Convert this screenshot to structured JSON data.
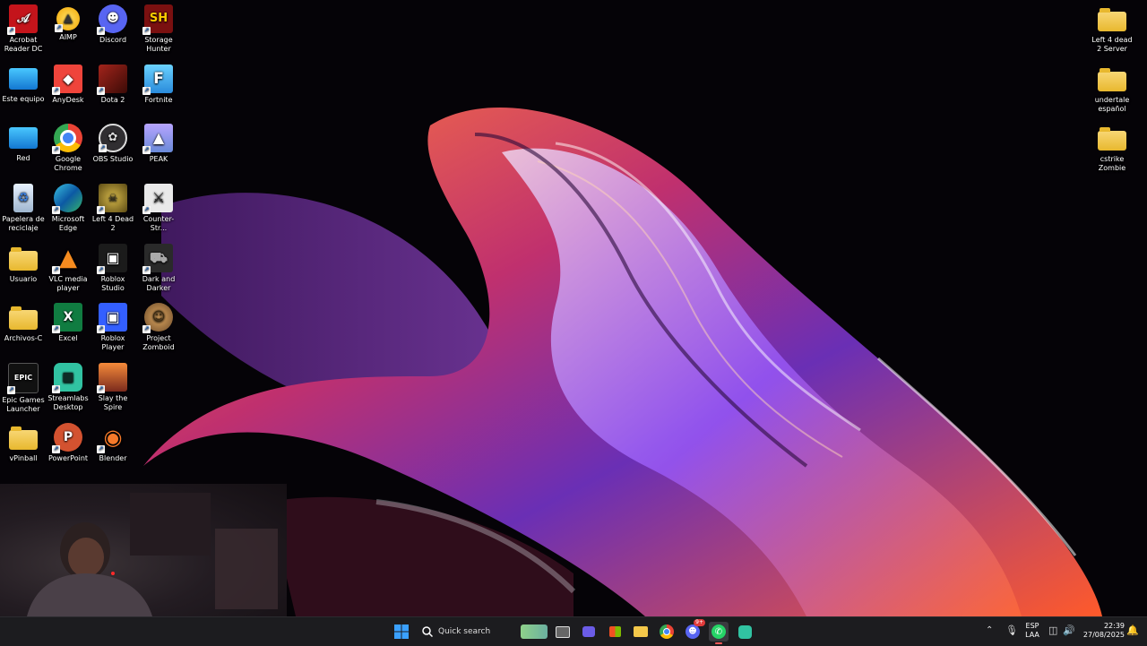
{
  "desktop_icons": {
    "acrobat": "Acrobat Reader DC",
    "aimp": "AIMP",
    "discord": "Discord",
    "storage_hunter": "Storage Hunter",
    "este_equipo": "Este equipo",
    "anydesk": "AnyDesk",
    "dota2": "Dota 2",
    "fortnite": "Fortnite",
    "red": "Red",
    "chrome": "Google Chrome",
    "obs": "OBS Studio",
    "peak": "PEAK",
    "papelera": "Papelera de reciclaje",
    "edge": "Microsoft Edge",
    "l4d2": "Left 4 Dead 2",
    "counter_strike": "Counter-Str...",
    "usuario": "Usuario",
    "vlc": "VLC media player",
    "roblox_studio": "Roblox Studio",
    "dark_darker": "Dark and Darker",
    "archivos": "Archivos-C",
    "excel": "Excel",
    "roblox_player": "Roblox Player",
    "zomboid": "Project Zomboid",
    "epic": "Epic Games Launcher",
    "streamlabs": "Streamlabs Desktop",
    "slay": "Slay the Spire",
    "vpinball": "vPinball",
    "powerpoint": "PowerPoint",
    "blender": "Blender",
    "l4d2_server": "Left 4 dead 2 Server",
    "undertale": "undertale español",
    "cstrike": "cstrike Zombie"
  },
  "icon_glyphs": {
    "storage_hunter": "SH",
    "fortnite": "F",
    "excel": "X",
    "epic": "EPIC",
    "powerpoint": "P"
  },
  "taskbar": {
    "search_label": "Quick search",
    "discord_badge": "9+",
    "lang_top": "ESP",
    "lang_bottom": "LAA",
    "time": "22:39",
    "date": "27/08/2025"
  },
  "colors": {
    "taskbar_bg": "#1c1c1f",
    "accent_windows": "#3aa0ff",
    "folder": "#f4c84a"
  }
}
